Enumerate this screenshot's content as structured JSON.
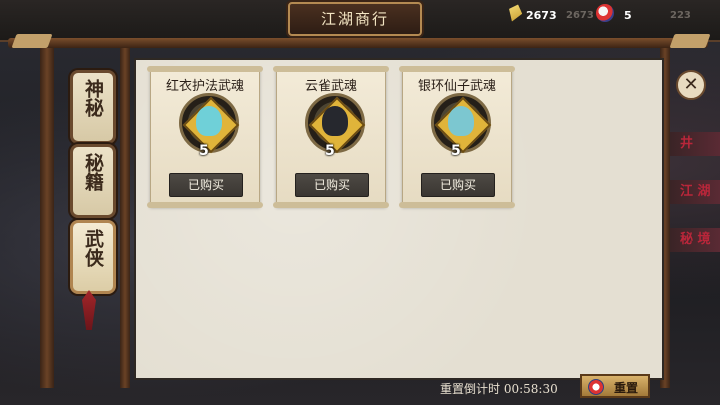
{
  "header": {
    "title": "江湖商行",
    "currency": {
      "amount": "2673",
      "icon": "gold-gem-icon",
      "shadow_amount": "2673"
    },
    "tickets": {
      "amount": "5",
      "icon": "ticket-icon",
      "shadow_amount": "223"
    }
  },
  "tabs": [
    {
      "label": "神秘",
      "active": false
    },
    {
      "label": "秘籍",
      "active": false
    },
    {
      "label": "武侠",
      "active": true
    }
  ],
  "items": [
    {
      "name": "红衣护法武魂",
      "count": "5",
      "button": "已购买",
      "figure_color": "#6fd0d8"
    },
    {
      "name": "云雀武魂",
      "count": "5",
      "button": "已购买",
      "figure_color": "#26282e"
    },
    {
      "name": "银环仙子武魂",
      "count": "5",
      "button": "已购买",
      "figure_color": "#7cc7d0"
    }
  ],
  "footer": {
    "reset_label": "重置倒计时",
    "countdown": "00:58:30",
    "reset_button": "重置"
  },
  "side_menu": [
    "井",
    "江 湖",
    "秘 境"
  ],
  "close_label": "✕",
  "colors": {
    "accent": "#b48a52",
    "panel": "#e4dfd2",
    "button": "#3a3632"
  }
}
